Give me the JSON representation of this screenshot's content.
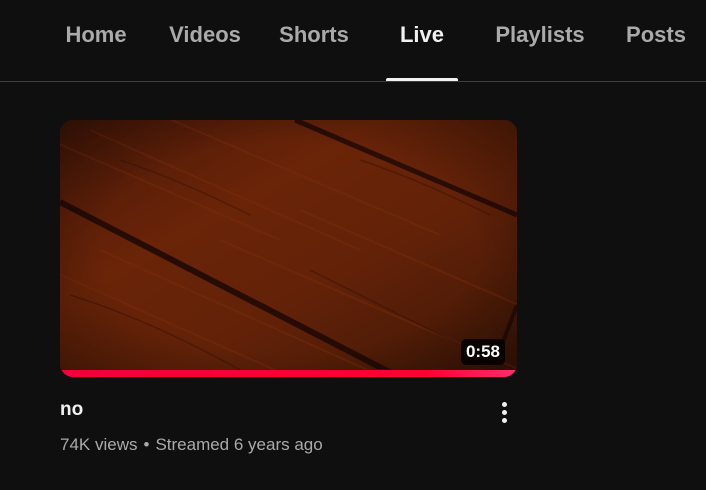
{
  "tabs": [
    {
      "label": "Home"
    },
    {
      "label": "Videos"
    },
    {
      "label": "Shorts"
    },
    {
      "label": "Live",
      "selected": true
    },
    {
      "label": "Playlists"
    },
    {
      "label": "Posts"
    }
  ],
  "video": {
    "title": "no",
    "duration": "0:58",
    "views": "74K views",
    "separator": "•",
    "streamed": "Streamed 6 years ago",
    "watch_progress": 1.0,
    "more_icon": "three-dots-vertical-icon"
  },
  "colors": {
    "background": "#0f0f0f",
    "progress": "#ff0033",
    "tab_active": "#f1f1f1",
    "tab_inactive": "#aaaaaa"
  }
}
